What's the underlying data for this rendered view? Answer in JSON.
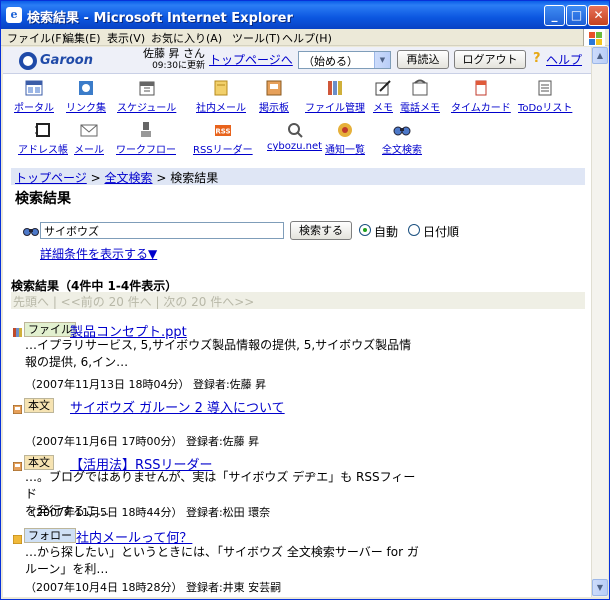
{
  "window": {
    "title": "検索結果 - Microsoft Internet Explorer",
    "menu": [
      "ファイル(F)",
      "編集(E)",
      "表示(V)",
      "お気に入り(A)",
      "ツール(T)",
      "ヘルプ(H)"
    ]
  },
  "header": {
    "logo": "Garoon",
    "user_name": "佐藤 昇 さん",
    "updated": "09:30に更新",
    "top_link": "トップページへ",
    "select_value": "（始める）",
    "reload": "再読込",
    "logout": "ログアウト",
    "help": "ヘルプ"
  },
  "apps_row1": [
    {
      "label": "ポータル",
      "icon": "portal-icon"
    },
    {
      "label": "リンク集",
      "icon": "link-icon"
    },
    {
      "label": "スケジュール",
      "icon": "schedule-icon"
    },
    {
      "label": "社内メール",
      "icon": "mail-icon"
    },
    {
      "label": "掲示板",
      "icon": "bulletin-icon"
    },
    {
      "label": "ファイル管理",
      "icon": "file-icon"
    },
    {
      "label": "メモ",
      "icon": "memo-icon"
    },
    {
      "label": "電話メモ",
      "icon": "phone-memo-icon"
    },
    {
      "label": "タイムカード",
      "icon": "timecard-icon"
    },
    {
      "label": "ToDoリスト",
      "icon": "todo-icon"
    }
  ],
  "apps_row2": [
    {
      "label": "アドレス帳",
      "icon": "address-book-icon"
    },
    {
      "label": "メール",
      "icon": "email-icon"
    },
    {
      "label": "ワークフロー",
      "icon": "workflow-icon"
    },
    {
      "label": "RSSリーダー",
      "icon": "rss-icon"
    },
    {
      "label": "cybozu.net",
      "icon": "cybozu-net-icon"
    },
    {
      "label": "通知一覧",
      "icon": "notification-icon"
    },
    {
      "label": "全文検索",
      "icon": "fulltext-search-icon"
    }
  ],
  "breadcrumb": {
    "top": "トップページ",
    "search": "全文検索",
    "current": "検索結果",
    "sep": ">"
  },
  "page_title": "検索結果",
  "search": {
    "value": "サイボウズ",
    "button": "検索する",
    "opt_relevance": "自動",
    "opt_date": "日付順",
    "advanced": "詳細条件を表示する▼"
  },
  "results_header": "検索結果（4件中 1-4件表示）",
  "pager": "先頭へ | <<前の 20 件へ | 次の 20 件へ>>",
  "results": [
    {
      "tag": "ファイル",
      "title": "製品コンセプト.ppt",
      "snippet_line1": "…イプラリサービス, 5,サイボウズ製品情報の提供, 5,サイボウズ製品情",
      "snippet_line2": "報の提供, 6,イン…",
      "meta": "（2007年11月13日 18時04分） 登録者:佐藤 昇"
    },
    {
      "tag": "本文",
      "title": "サイボウズ ガルーン 2 導入について",
      "meta": "（2007年11月6日 17時00分） 登録者:佐藤 昇"
    },
    {
      "tag": "本文",
      "title": "【活用法】RSSリーダー",
      "snippet_line1": "…。ブログではありませんが、実は「サイボウズ デヂエ」も RSSフィード",
      "snippet_line2": "を発行するこ…",
      "meta": "（2007年11月5日 18時44分） 登録者:松田 環奈"
    },
    {
      "tag": "フォロー",
      "title": "社内メールって何？",
      "snippet_line1": "…から探したい」というときには、「サイボウズ 全文検索サーバー for ガ",
      "snippet_line2": "ルーン」を利…",
      "meta": "（2007年10月4日 18時28分） 登録者:井東 安芸嗣"
    }
  ]
}
